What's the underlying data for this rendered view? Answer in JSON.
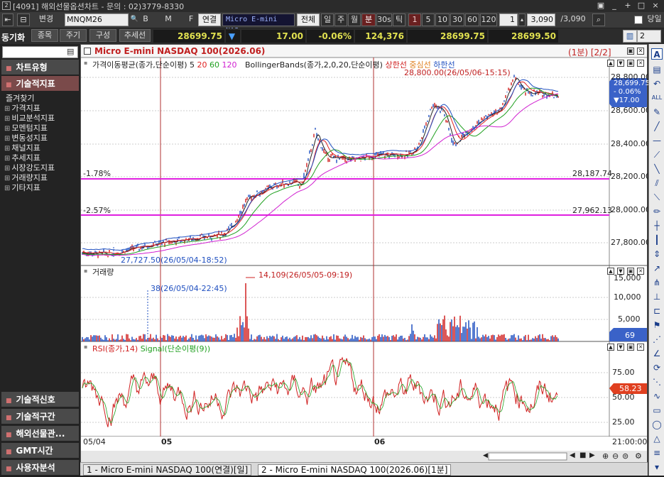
{
  "window": {
    "icon_label": "2",
    "title": "[4091] 해외선물옵션차트 - 문의 : 02)3779-8330",
    "buttons": [
      "▣",
      "_",
      "+",
      "□",
      "×"
    ]
  },
  "toolbar1": {
    "change_label": "변경",
    "symbol_code": "MNQM26",
    "link_label": "연결",
    "symbol_name": "Micro E-mini NAS",
    "all_label": "전체",
    "period_day": "일",
    "period_week": "주",
    "period_month": "월",
    "period_min": "분",
    "period_30s": "30s",
    "period_tick": "틱",
    "intervals": [
      "1",
      "5",
      "10",
      "30",
      "60",
      "120"
    ],
    "interval_value": "1",
    "count_value": "3,090",
    "count_total": "/3,090",
    "letters": [
      "Q",
      "B",
      "M",
      "F"
    ],
    "same_day_label": "당일"
  },
  "toolbar2": {
    "sync_label": "동기화",
    "tabs": [
      "종목",
      "주기",
      "구성",
      "추세선"
    ],
    "price": "28699.75",
    "change": "17.00",
    "change_pct": "-0.06%",
    "volume": "124,376",
    "bid": "28699.75",
    "ask": "28699.50",
    "layout_count": "2"
  },
  "sidebar": {
    "headers_top": [
      "차트유형",
      "기술적지표"
    ],
    "items": [
      "즐겨찾기",
      "가격지표",
      "비교분석지표",
      "모멘텀지표",
      "변동성지표",
      "채널지표",
      "추세지표",
      "시장강도지표",
      "거래량지표",
      "기타지표"
    ],
    "headers_bottom": [
      "기술적신호",
      "기술적구간",
      "해외선물관...",
      "GMT시간",
      "사용자분석"
    ]
  },
  "chart": {
    "title": "Micro E-mini NASDAQ 100(2026.06)",
    "page_info": "(1분) [2/2]",
    "legend_ma": "가격이동평균(종가,단순이평) 5",
    "ma_periods": [
      "20",
      "60",
      "120"
    ],
    "legend_bb": "BollingerBands(종가,2,0,20,단순이평)",
    "bb_upper": "상한선",
    "bb_mid": "중심선",
    "bb_lower": "하한선",
    "max_annotation": "28,800.00(26/05/06-15:15)",
    "min_annotation": "27,727.50(26/05/04-18:52)",
    "hline1_pct": "-1.78%",
    "hline1_val": "28,187.74",
    "hline2_pct": "-2.57%",
    "hline2_val": "27,962.13",
    "price_axis": [
      "28,800.00",
      "28,600.00",
      "28,400.00",
      "28,200.00",
      "28,000.00",
      "27,800.00"
    ],
    "price_tag": [
      "28,699.75",
      "- 0.06%",
      "▼17.00"
    ],
    "volume_title": "거래량",
    "vol_max_annotation": "14,109(26/05/05-09:19)",
    "vol_min_annotation": "38(26/05/04-22:45)",
    "volume_axis": [
      "15,000",
      "10,000",
      "5,000"
    ],
    "volume_tag": "69",
    "rsi_title": "RSI(종가,14)",
    "rsi_signal": "Signal(단순이평(9))",
    "rsi_axis": [
      "75.00",
      "50.00",
      "25.00"
    ],
    "rsi_tag": "58.23",
    "x_labels": [
      "05/04",
      "05",
      "06"
    ],
    "x_time": "21:00:00",
    "colors": {
      "up": "#d02020",
      "down": "#2050c0",
      "ma5": "#222222",
      "ma20": "#e02020",
      "ma60": "#20a020",
      "ma120": "#d020d0",
      "hline": "#e020e0"
    }
  },
  "chart_data": [
    {
      "type": "line",
      "title": "Micro E-mini NASDAQ 100(2026.06)",
      "series": [
        {
          "name": "가격",
          "x": [
            "05/04",
            "05",
            "06"
          ],
          "values": [
            27740,
            28180,
            28699.75
          ]
        }
      ],
      "ylim": [
        27700,
        28850
      ]
    },
    {
      "type": "bar",
      "title": "거래량",
      "ylim": [
        0,
        16000
      ]
    },
    {
      "type": "line",
      "title": "RSI(종가,14)",
      "ylim": [
        15,
        100
      ]
    }
  ],
  "tabs": [
    "1 - Micro E-mini NASDAQ 100(연결)[일]",
    "2 - Micro E-mini NASDAQ 100(2026.06)[1분]"
  ]
}
